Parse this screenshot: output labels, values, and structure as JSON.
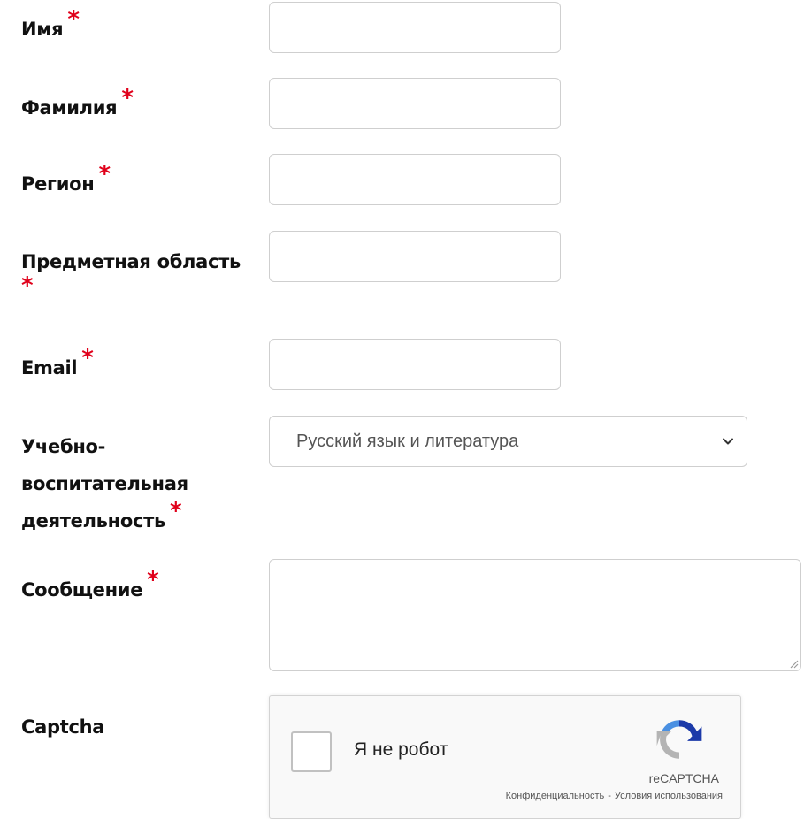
{
  "form": {
    "required_marker": "*",
    "fields": {
      "first_name": {
        "label": "Имя",
        "value": ""
      },
      "last_name": {
        "label": "Фамилия",
        "value": ""
      },
      "region": {
        "label": "Регион",
        "value": ""
      },
      "subject_area": {
        "label": "Предметная область",
        "value": ""
      },
      "email": {
        "label": "Email",
        "value": ""
      },
      "activity": {
        "label_lines": [
          "Учебно-",
          "воспитательная",
          "деятельность"
        ],
        "selected": "Русский язык и литература"
      },
      "message": {
        "label": "Сообщение",
        "value": ""
      },
      "captcha": {
        "label": "Captcha"
      }
    }
  },
  "recaptcha": {
    "checkbox_label": "Я не робот",
    "brand": "reCAPTCHA",
    "privacy": "Конфиденциальность",
    "separator": "-",
    "terms": "Условия использования"
  },
  "colors": {
    "required": "#e0001a",
    "border": "#cfcfcf",
    "recaptcha_blue": "#1c3aa9",
    "recaptcha_lightblue": "#4a90e2",
    "recaptcha_gray": "#b4b4b4"
  }
}
